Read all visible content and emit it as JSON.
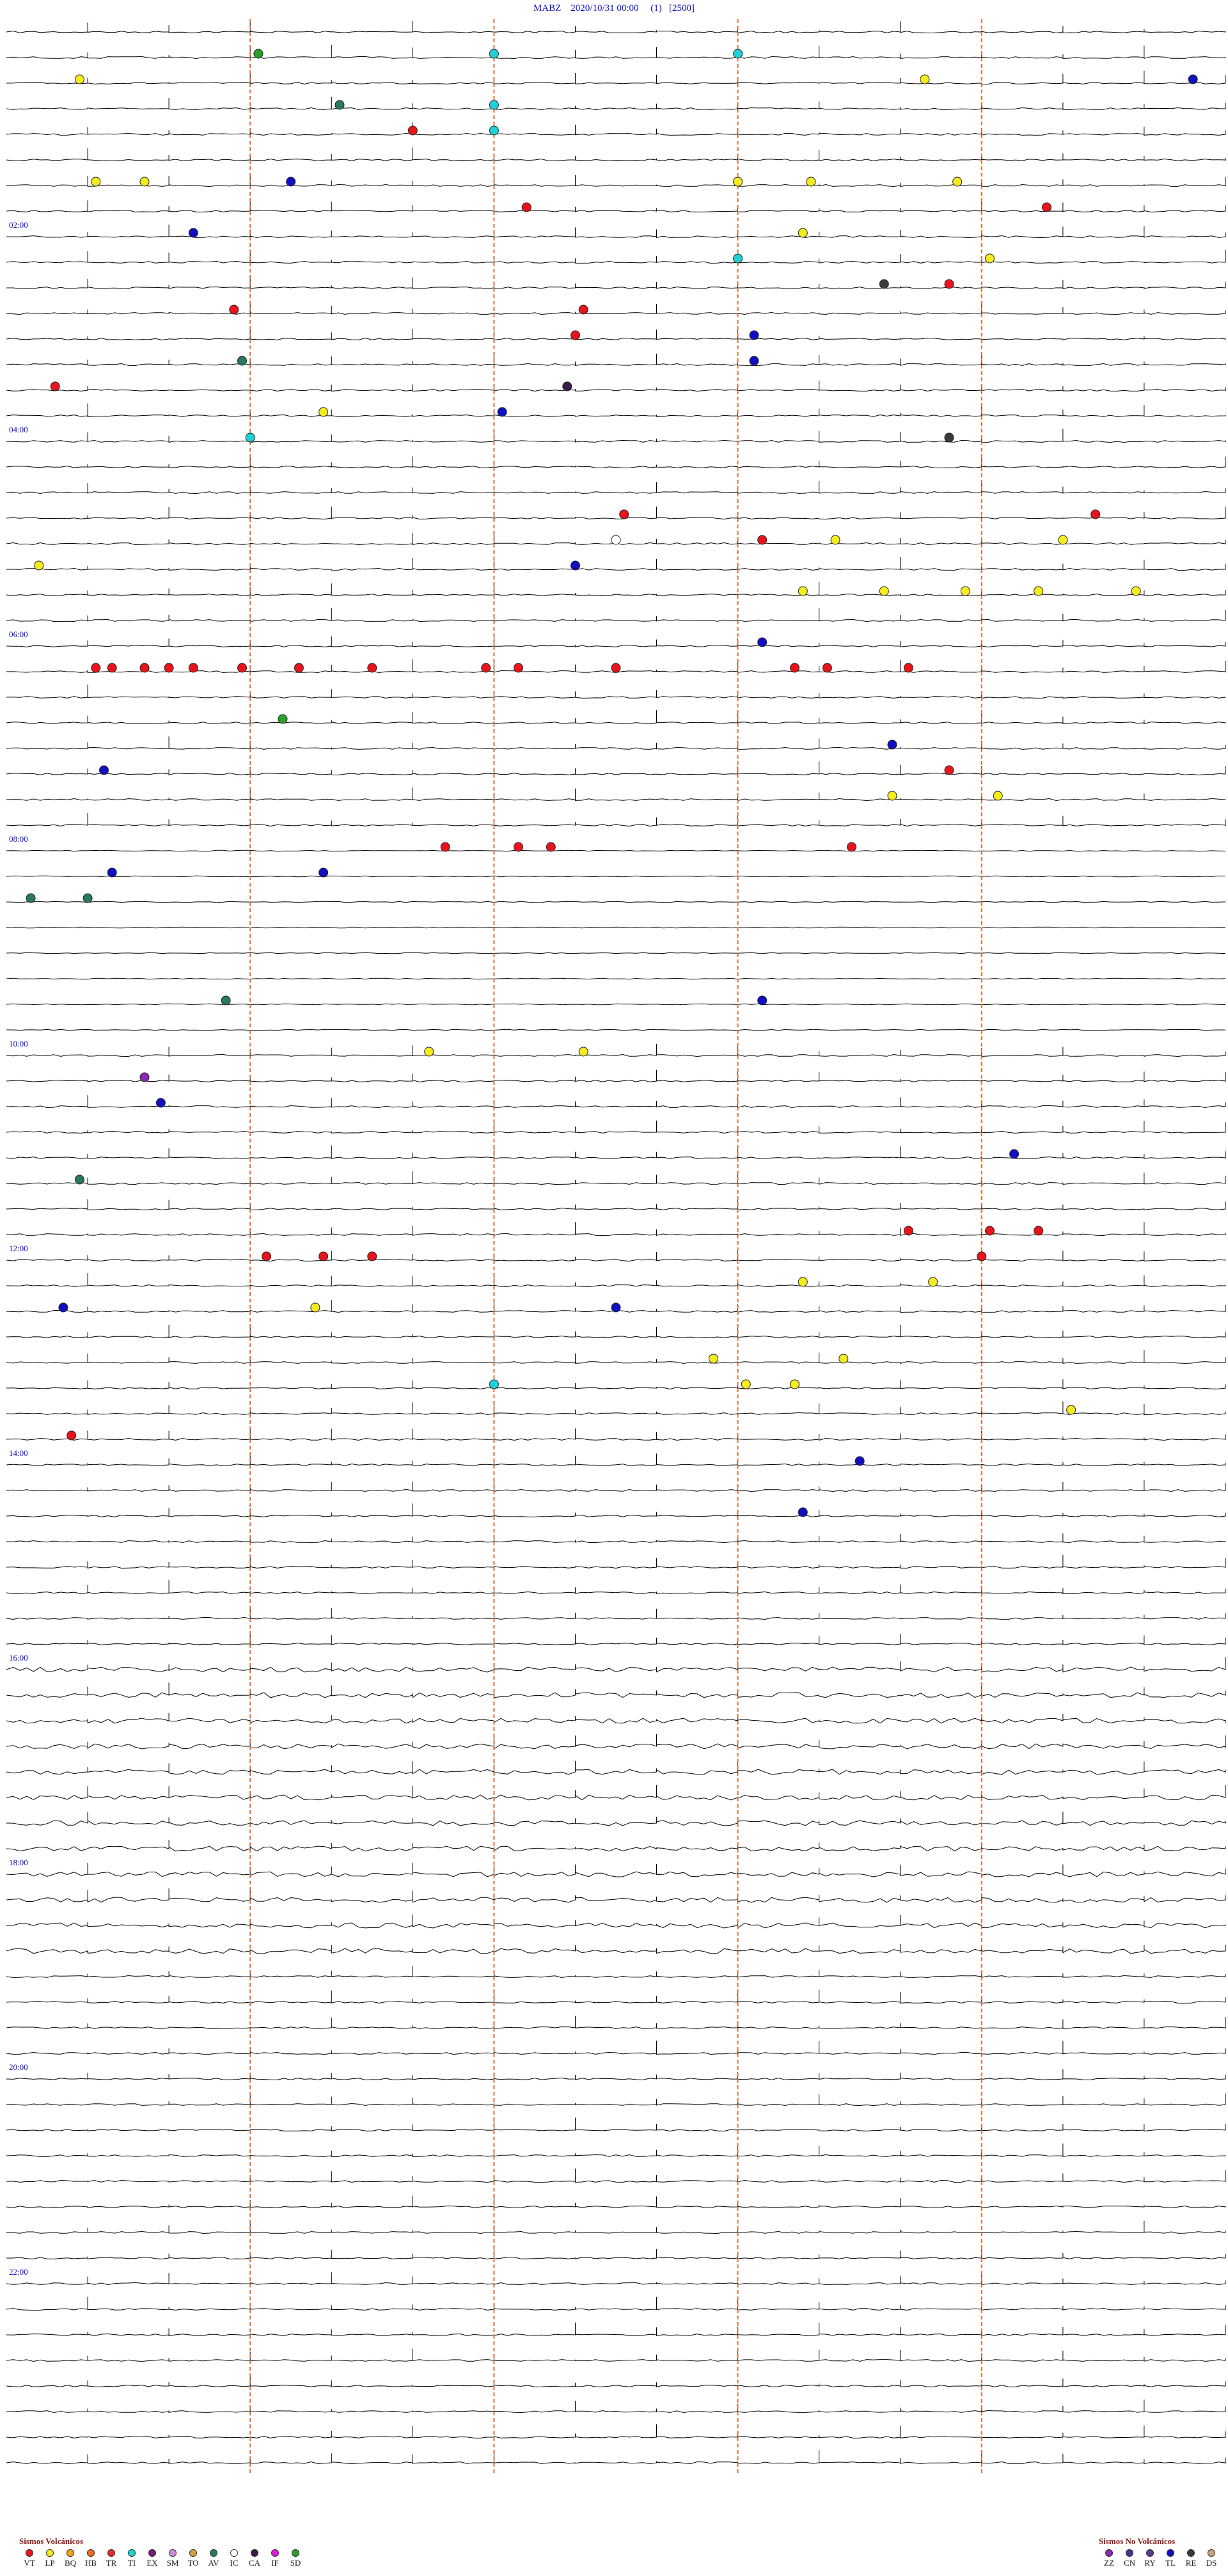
{
  "header": {
    "station": "MABZ",
    "datetime": "2020/10/31 00:00",
    "channel": "(1)",
    "gain": "[2500]"
  },
  "legend": {
    "volcanic_title": "Sismos Volcánicos",
    "nonvolcanic_title": "Sismos No Volcánicos",
    "volcanic": [
      {
        "code": "VT",
        "color": "#e8141c"
      },
      {
        "code": "LP",
        "color": "#f4ec1e"
      },
      {
        "code": "BQ",
        "color": "#f7a21b"
      },
      {
        "code": "HB",
        "color": "#f26b1f"
      },
      {
        "code": "TR",
        "color": "#e82a2a"
      },
      {
        "code": "TI",
        "color": "#1ed2d8"
      },
      {
        "code": "EX",
        "color": "#7a1a7a"
      },
      {
        "code": "SM",
        "color": "#c890d8"
      },
      {
        "code": "TO",
        "color": "#d8a040"
      },
      {
        "code": "AV",
        "color": "#2a7a5a"
      },
      {
        "code": "IC",
        "color": "#ffffff"
      },
      {
        "code": "CA",
        "color": "#3a1a4a"
      },
      {
        "code": "IF",
        "color": "#e01ae0"
      },
      {
        "code": "SD",
        "color": "#2aa02a"
      }
    ],
    "nonvolcanic": [
      {
        "code": "ZZ",
        "color": "#8a2ab0"
      },
      {
        "code": "CN",
        "color": "#3a3a8a"
      },
      {
        "code": "RY",
        "color": "#5a3a8a"
      },
      {
        "code": "TL",
        "color": "#1010c0"
      },
      {
        "code": "RE",
        "color": "#3a3a3a"
      },
      {
        "code": "DS",
        "color": "#c8a07a"
      }
    ]
  },
  "chart_data": {
    "type": "helicorder",
    "station": "MABZ",
    "start": "2020/10/31 00:00",
    "rows_per_hour": 4,
    "minutes_per_row": 15,
    "time_labels": [
      "02:00",
      "04:00",
      "06:00",
      "08:00",
      "10:00",
      "12:00",
      "14:00",
      "16:00",
      "18:00",
      "20:00",
      "22:00"
    ],
    "label_color": "#1010c0",
    "trace_color": "#000000",
    "marker_line_color": "#e07030",
    "minute_markers": [
      3,
      6,
      9,
      12
    ],
    "event_counts_note": "",
    "events": [
      {
        "row": 1,
        "minute": 6.0,
        "type": "TI"
      },
      {
        "row": 1,
        "minute": 9.0,
        "type": "TI"
      },
      {
        "row": 1,
        "minute": 3.1,
        "type": "SD"
      },
      {
        "row": 2,
        "minute": 0.9,
        "type": "LP"
      },
      {
        "row": 2,
        "minute": 11.3,
        "type": "LP"
      },
      {
        "row": 2,
        "minute": 14.6,
        "type": "TL"
      },
      {
        "row": 3,
        "minute": 6.0,
        "type": "TI"
      },
      {
        "row": 3,
        "minute": 4.1,
        "type": "AV"
      },
      {
        "row": 4,
        "minute": 6.0,
        "type": "TI"
      },
      {
        "row": 4,
        "minute": 5.0,
        "type": "VT"
      },
      {
        "row": 6,
        "minute": 1.1,
        "type": "LP"
      },
      {
        "row": 6,
        "minute": 1.7,
        "type": "LP"
      },
      {
        "row": 6,
        "minute": 3.5,
        "type": "TL"
      },
      {
        "row": 6,
        "minute": 9.0,
        "type": "LP"
      },
      {
        "row": 6,
        "minute": 9.9,
        "type": "LP"
      },
      {
        "row": 6,
        "minute": 11.7,
        "type": "LP"
      },
      {
        "row": 7,
        "minute": 6.4,
        "type": "VT"
      },
      {
        "row": 7,
        "minute": 12.8,
        "type": "VT"
      },
      {
        "row": 8,
        "minute": 2.3,
        "type": "TL"
      },
      {
        "row": 8,
        "minute": 9.8,
        "type": "LP"
      },
      {
        "row": 9,
        "minute": 9.0,
        "type": "TI"
      },
      {
        "row": 9,
        "minute": 12.1,
        "type": "LP"
      },
      {
        "row": 10,
        "minute": 10.8,
        "type": "RE"
      },
      {
        "row": 10,
        "minute": 11.6,
        "type": "VT"
      },
      {
        "row": 11,
        "minute": 2.8,
        "type": "VT"
      },
      {
        "row": 11,
        "minute": 7.1,
        "type": "VT"
      },
      {
        "row": 12,
        "minute": 7.0,
        "type": "VT"
      },
      {
        "row": 12,
        "minute": 9.2,
        "type": "TL"
      },
      {
        "row": 13,
        "minute": 2.9,
        "type": "AV"
      },
      {
        "row": 13,
        "minute": 9.2,
        "type": "TL"
      },
      {
        "row": 14,
        "minute": 0.6,
        "type": "VT"
      },
      {
        "row": 14,
        "minute": 6.9,
        "type": "CA"
      },
      {
        "row": 15,
        "minute": 3.9,
        "type": "LP"
      },
      {
        "row": 15,
        "minute": 6.1,
        "type": "TL"
      },
      {
        "row": 16,
        "minute": 3.0,
        "type": "TI"
      },
      {
        "row": 16,
        "minute": 11.6,
        "type": "RE"
      },
      {
        "row": 19,
        "minute": 7.6,
        "type": "VT"
      },
      {
        "row": 19,
        "minute": 13.4,
        "type": "VT"
      },
      {
        "row": 20,
        "minute": 7.5,
        "type": "IC"
      },
      {
        "row": 20,
        "minute": 9.3,
        "type": "VT"
      },
      {
        "row": 20,
        "minute": 10.2,
        "type": "LP"
      },
      {
        "row": 20,
        "minute": 13.0,
        "type": "LP"
      },
      {
        "row": 21,
        "minute": 7.0,
        "type": "TL"
      },
      {
        "row": 21,
        "minute": 0.4,
        "type": "LP"
      },
      {
        "row": 22,
        "minute": 9.8,
        "type": "LP"
      },
      {
        "row": 22,
        "minute": 10.8,
        "type": "LP"
      },
      {
        "row": 22,
        "minute": 11.8,
        "type": "LP"
      },
      {
        "row": 22,
        "minute": 12.7,
        "type": "LP"
      },
      {
        "row": 22,
        "minute": 13.9,
        "type": "LP"
      },
      {
        "row": 24,
        "minute": 9.3,
        "type": "TL"
      },
      {
        "row": 25,
        "minute": 1.1,
        "type": "VT"
      },
      {
        "row": 25,
        "minute": 1.3,
        "type": "VT"
      },
      {
        "row": 25,
        "minute": 1.7,
        "type": "VT"
      },
      {
        "row": 25,
        "minute": 2.0,
        "type": "VT"
      },
      {
        "row": 25,
        "minute": 2.3,
        "type": "VT"
      },
      {
        "row": 25,
        "minute": 2.9,
        "type": "VT"
      },
      {
        "row": 25,
        "minute": 3.6,
        "type": "VT"
      },
      {
        "row": 25,
        "minute": 4.5,
        "type": "VT"
      },
      {
        "row": 25,
        "minute": 5.9,
        "type": "VT"
      },
      {
        "row": 25,
        "minute": 6.3,
        "type": "VT"
      },
      {
        "row": 25,
        "minute": 7.5,
        "type": "VT"
      },
      {
        "row": 25,
        "minute": 9.7,
        "type": "VT"
      },
      {
        "row": 25,
        "minute": 10.1,
        "type": "VT"
      },
      {
        "row": 25,
        "minute": 11.1,
        "type": "VT"
      },
      {
        "row": 27,
        "minute": 3.4,
        "type": "SD"
      },
      {
        "row": 28,
        "minute": 10.9,
        "type": "TL"
      },
      {
        "row": 29,
        "minute": 1.2,
        "type": "TL"
      },
      {
        "row": 29,
        "minute": 11.6,
        "type": "VT"
      },
      {
        "row": 30,
        "minute": 10.9,
        "type": "LP"
      },
      {
        "row": 30,
        "minute": 12.2,
        "type": "LP"
      },
      {
        "row": 32,
        "minute": 5.4,
        "type": "VT"
      },
      {
        "row": 32,
        "minute": 6.3,
        "type": "VT"
      },
      {
        "row": 32,
        "minute": 6.7,
        "type": "VT"
      },
      {
        "row": 32,
        "minute": 10.4,
        "type": "VT"
      },
      {
        "row": 33,
        "minute": 1.3,
        "type": "TL"
      },
      {
        "row": 33,
        "minute": 3.9,
        "type": "TL"
      },
      {
        "row": 34,
        "minute": 0.3,
        "type": "AV"
      },
      {
        "row": 34,
        "minute": 1.0,
        "type": "AV"
      },
      {
        "row": 38,
        "minute": 2.7,
        "type": "AV"
      },
      {
        "row": 38,
        "minute": 9.3,
        "type": "TL"
      },
      {
        "row": 40,
        "minute": 5.2,
        "type": "LP"
      },
      {
        "row": 40,
        "minute": 7.1,
        "type": "LP"
      },
      {
        "row": 41,
        "minute": 1.7,
        "type": "ZZ"
      },
      {
        "row": 42,
        "minute": 1.9,
        "type": "TL"
      },
      {
        "row": 44,
        "minute": 12.4,
        "type": "TL"
      },
      {
        "row": 45,
        "minute": 0.9,
        "type": "AV"
      },
      {
        "row": 47,
        "minute": 12.7,
        "type": "VT"
      },
      {
        "row": 47,
        "minute": 12.1,
        "type": "VT"
      },
      {
        "row": 47,
        "minute": 11.1,
        "type": "VT"
      },
      {
        "row": 48,
        "minute": 12.0,
        "type": "VT"
      },
      {
        "row": 48,
        "minute": 3.2,
        "type": "VT"
      },
      {
        "row": 48,
        "minute": 3.9,
        "type": "VT"
      },
      {
        "row": 48,
        "minute": 4.5,
        "type": "VT"
      },
      {
        "row": 49,
        "minute": 9.8,
        "type": "LP"
      },
      {
        "row": 49,
        "minute": 11.4,
        "type": "LP"
      },
      {
        "row": 50,
        "minute": 0.7,
        "type": "TL"
      },
      {
        "row": 50,
        "minute": 3.8,
        "type": "LP"
      },
      {
        "row": 50,
        "minute": 7.5,
        "type": "TL"
      },
      {
        "row": 52,
        "minute": 8.7,
        "type": "LP"
      },
      {
        "row": 52,
        "minute": 10.3,
        "type": "LP"
      },
      {
        "row": 53,
        "minute": 9.1,
        "type": "LP"
      },
      {
        "row": 53,
        "minute": 9.7,
        "type": "LP"
      },
      {
        "row": 53,
        "minute": 6.0,
        "type": "TI"
      },
      {
        "row": 54,
        "minute": 13.1,
        "type": "LP"
      },
      {
        "row": 55,
        "minute": 0.8,
        "type": "VT"
      },
      {
        "row": 56,
        "minute": 10.5,
        "type": "TL"
      },
      {
        "row": 58,
        "minute": 9.8,
        "type": "TL"
      }
    ]
  }
}
